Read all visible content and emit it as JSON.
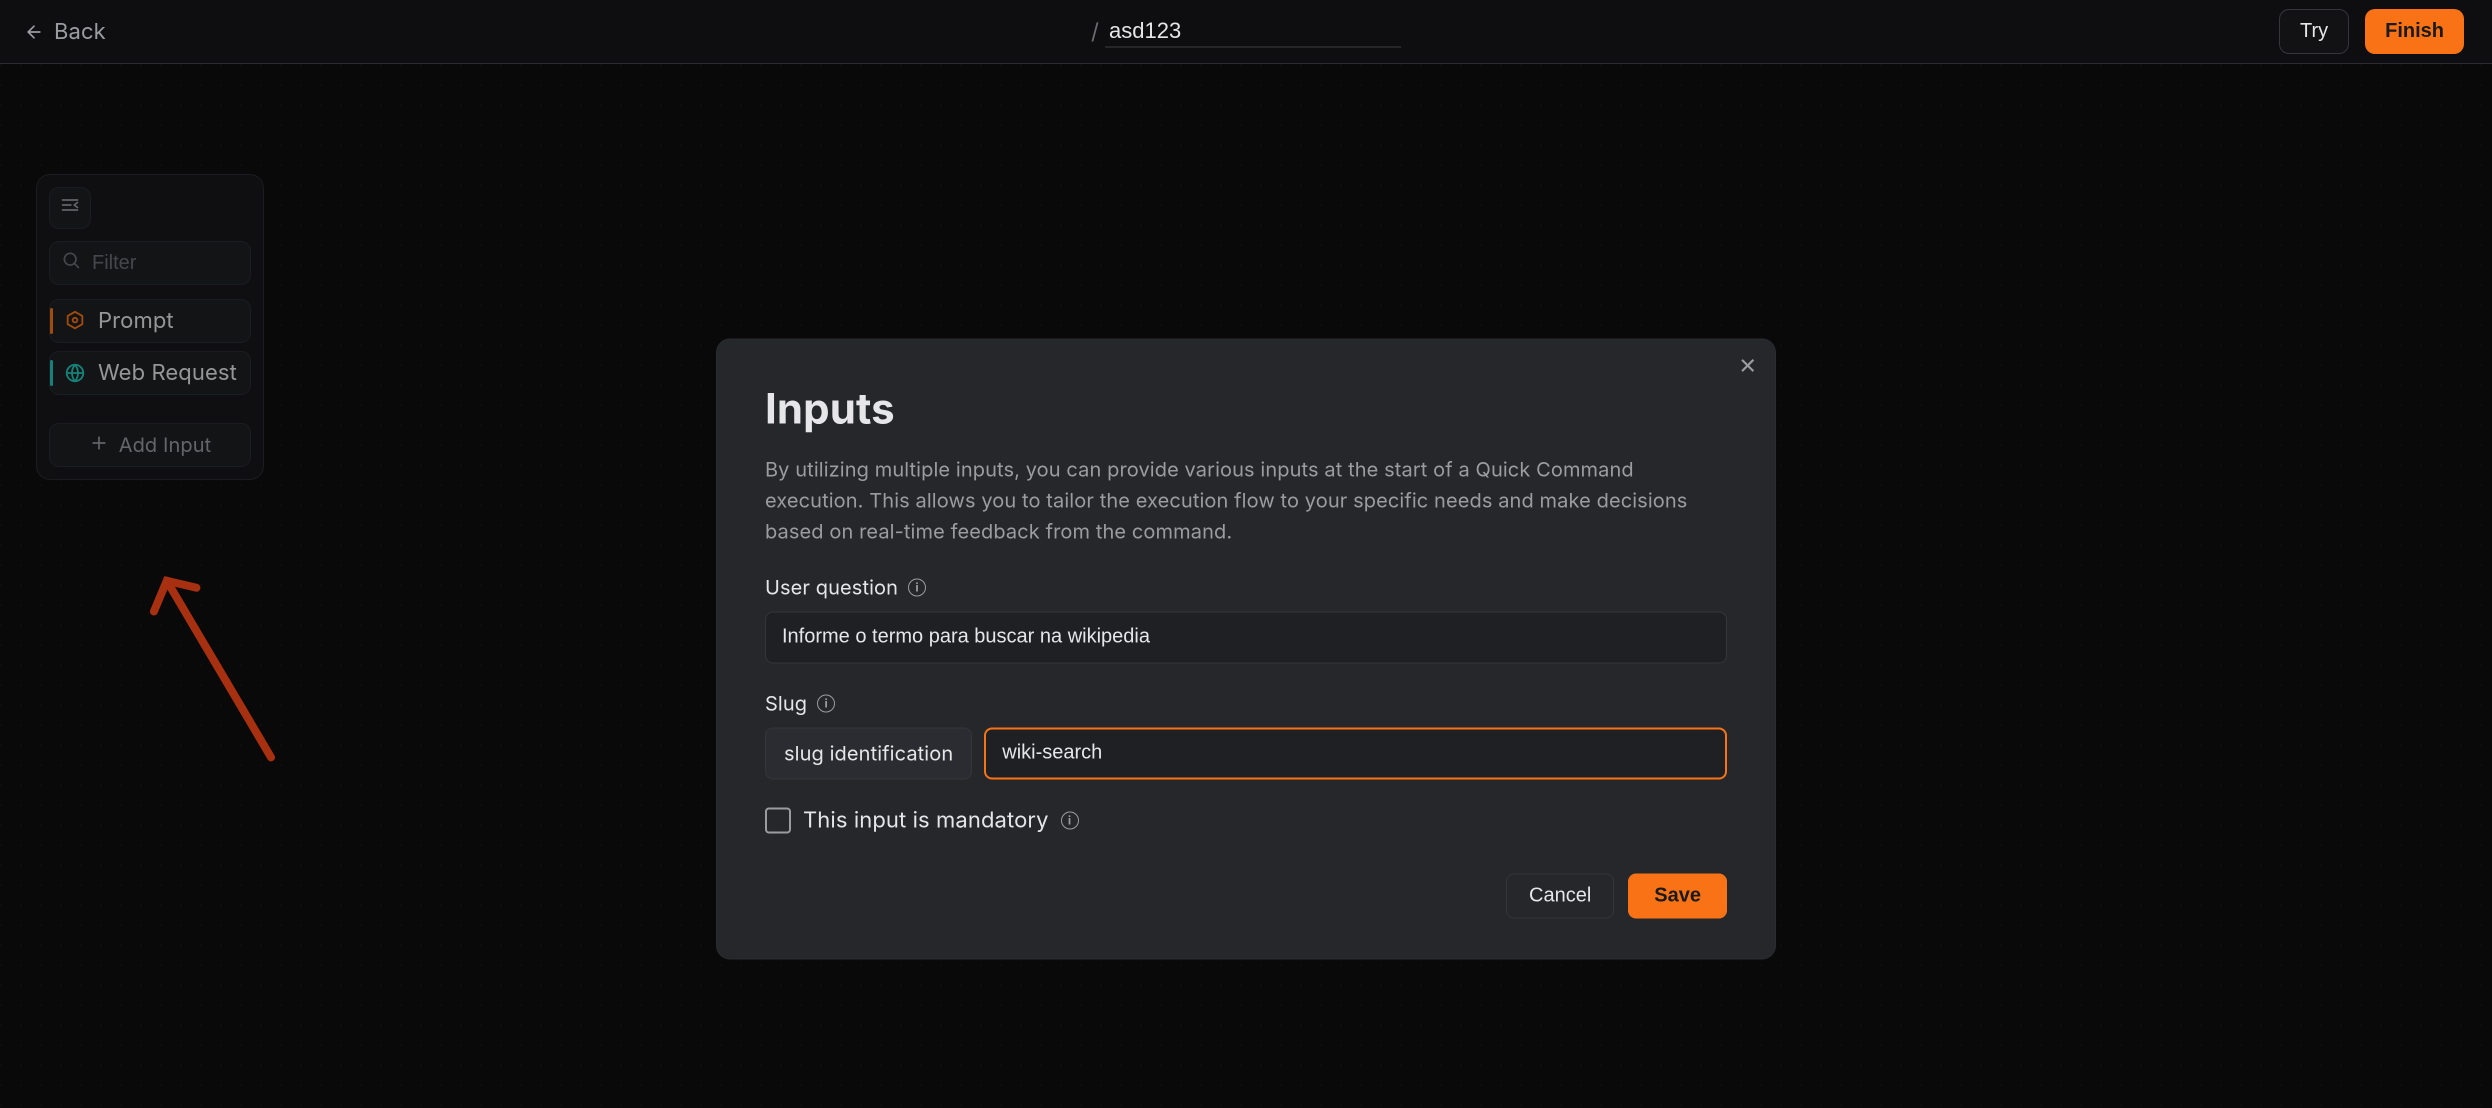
{
  "header": {
    "back_label": "Back",
    "title_input_value": "asd123",
    "try_label": "Try",
    "finish_label": "Finish"
  },
  "sidebar": {
    "filter_placeholder": "Filter",
    "items": [
      {
        "label": "Prompt",
        "icon": "hexagon-icon",
        "variant": "orange"
      },
      {
        "label": "Web Request",
        "icon": "globe-icon",
        "variant": "teal"
      }
    ],
    "add_input_label": "Add Input"
  },
  "modal": {
    "title": "Inputs",
    "description": "By utilizing multiple inputs, you can provide various inputs at the start of a Quick Command execution. This allows you to tailor the execution flow to your specific needs and make decisions based on real-time feedback from the command.",
    "fields": {
      "user_question": {
        "label": "User question",
        "value": "Informe o termo para buscar na wikipedia"
      },
      "slug": {
        "label": "Slug",
        "chip_label": "slug identification",
        "value": "wiki-search"
      },
      "mandatory_label": "This input is mandatory",
      "mandatory_checked": false
    },
    "cancel_label": "Cancel",
    "save_label": "Save"
  }
}
